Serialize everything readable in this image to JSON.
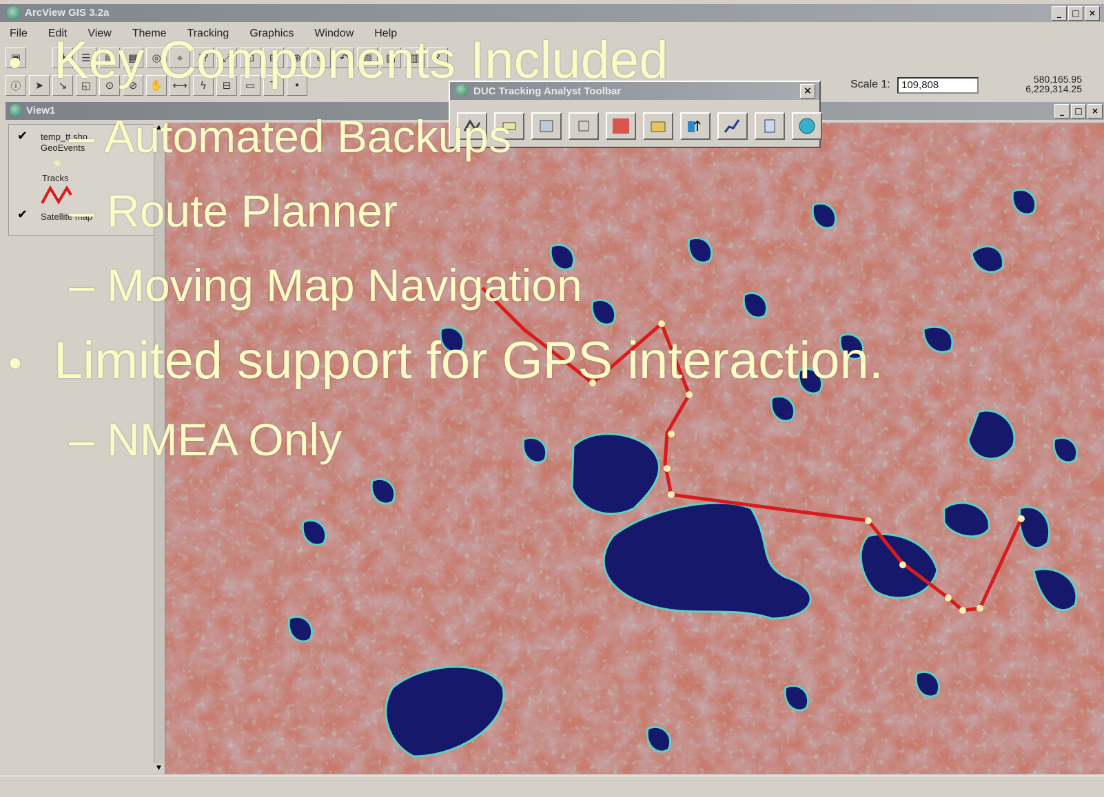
{
  "app": {
    "title": "ArcView GIS 3.2a"
  },
  "window_buttons": {
    "minimize": "_",
    "maximize": "□",
    "close": "×"
  },
  "menu": [
    "File",
    "Edit",
    "View",
    "Theme",
    "Tracking",
    "Graphics",
    "Window",
    "Help"
  ],
  "scale": {
    "label": "Scale 1:",
    "value": "109,808"
  },
  "coords": {
    "x": "580,165.95",
    "y": "6,229,314.25"
  },
  "view": {
    "title": "View1"
  },
  "toc": {
    "layer1_name": "temp_tt.shp",
    "layer1_sub": "GeoEvents",
    "layer1_legend": "Tracks",
    "layer2_name": "Satellite map",
    "check": "✔"
  },
  "floating_toolbar": {
    "title": "DUC Tracking Analyst Toolbar",
    "close": "×"
  },
  "slide": {
    "bullet": "•",
    "heading1": "Key Components Included",
    "sub1": "– Automated Backups",
    "sub2": "– Route Planner",
    "sub3": "– Moving Map Navigation",
    "heading2": "Limited support for GPS interaction.",
    "sub4": "– NMEA Only"
  },
  "colors": {
    "track": "#d81c1c",
    "water": "#15186b",
    "land": "#c87a6c",
    "slide_text": "#fbfbc6"
  }
}
